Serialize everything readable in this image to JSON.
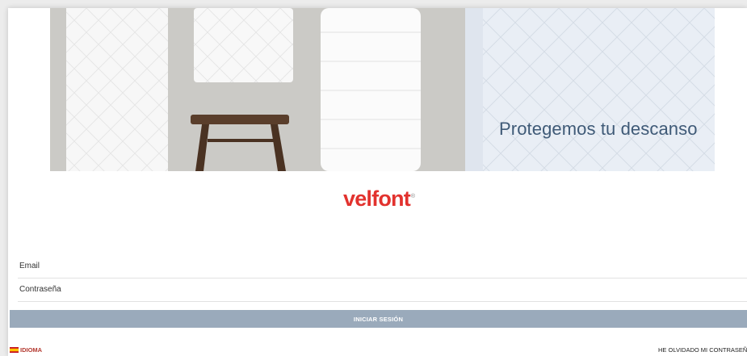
{
  "hero": {
    "tagline": "Protegemos tu descanso"
  },
  "brand": {
    "logo_text": "velfont",
    "registered_mark": "®",
    "color": "#e2322e"
  },
  "form": {
    "email_label": "Email",
    "email_value": "",
    "password_label": "Contraseña",
    "password_value": "",
    "submit_label": "INICIAR SESIÓN",
    "submit_color": "#9aaabb"
  },
  "footer": {
    "language_label": "IDIOMA",
    "language_flag": "spain-flag-icon",
    "forgot_password_label": "HE OLVIDADO MI CONTRASEÑA"
  }
}
